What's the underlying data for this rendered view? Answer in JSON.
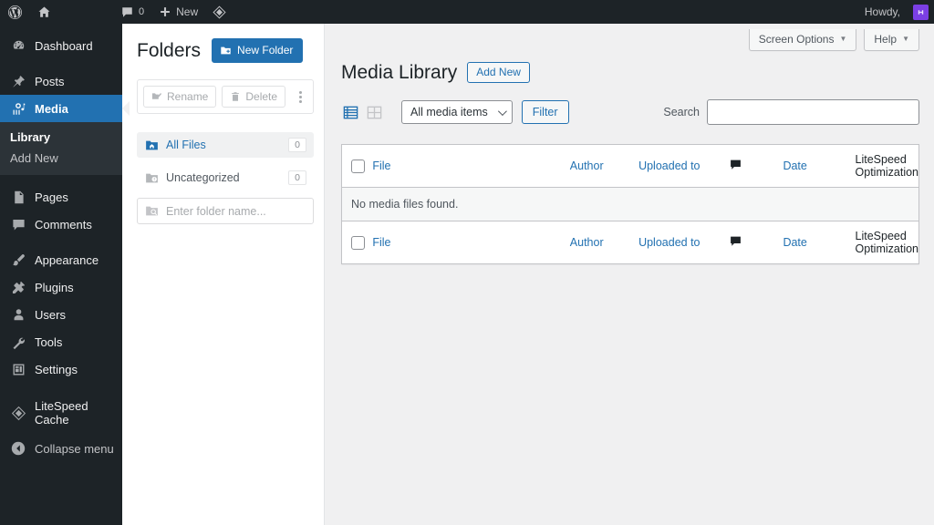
{
  "adminbar": {
    "wp_logo": "wordpress-logo",
    "site_home": "site-home",
    "comments_icon": "comments-icon",
    "comments_count": "0",
    "new_label": "New",
    "litespeed_icon": "litespeed-icon",
    "howdy": "Howdy,",
    "avatar": "avatar"
  },
  "sidebar": {
    "items": [
      {
        "label": "Dashboard",
        "icon": "dashboard-icon",
        "current": false
      },
      {
        "label": "Posts",
        "icon": "pin-icon",
        "current": false
      },
      {
        "label": "Media",
        "icon": "media-icon",
        "current": true
      },
      {
        "label": "Pages",
        "icon": "pages-icon",
        "current": false
      },
      {
        "label": "Comments",
        "icon": "comments-icon",
        "current": false
      },
      {
        "label": "Appearance",
        "icon": "brush-icon",
        "current": false
      },
      {
        "label": "Plugins",
        "icon": "plugins-icon",
        "current": false
      },
      {
        "label": "Users",
        "icon": "users-icon",
        "current": false
      },
      {
        "label": "Tools",
        "icon": "tools-icon",
        "current": false
      },
      {
        "label": "Settings",
        "icon": "settings-icon",
        "current": false
      },
      {
        "label": "LiteSpeed Cache",
        "icon": "litespeed-icon",
        "current": false
      }
    ],
    "submenu": [
      {
        "label": "Library",
        "current": true
      },
      {
        "label": "Add New",
        "current": false
      }
    ],
    "collapse_label": "Collapse menu",
    "collapse_icon": "collapse-arrow-icon",
    "active_color": "#2271b1"
  },
  "folders": {
    "title": "Folders",
    "new_folder_label": "New Folder",
    "new_folder_icon": "folder-plus-icon",
    "rename_label": "Rename",
    "rename_icon": "rename-folder-icon",
    "delete_label": "Delete",
    "delete_icon": "trash-icon",
    "more_icon": "kebab-menu-icon",
    "list": [
      {
        "label": "All Files",
        "count": "0",
        "icon": "home-folder-icon",
        "active": true
      },
      {
        "label": "Uncategorized",
        "count": "0",
        "icon": "folder-icon",
        "active": false
      }
    ],
    "new_folder_placeholder": "Enter folder name...",
    "new_folder_input_value": "",
    "search_folder_icon": "folder-search-icon"
  },
  "screen_meta": {
    "screen_options": "Screen Options",
    "help": "Help",
    "caret": "▼"
  },
  "main": {
    "page_title": "Media Library",
    "add_new_label": "Add New",
    "view_list_icon": "list-view-icon",
    "view_grid_icon": "grid-view-icon",
    "media_filter_selected": "All media items",
    "filter_label": "Filter",
    "search_label": "Search",
    "search_value": "",
    "search_placeholder": ""
  },
  "table": {
    "columns": {
      "file": "File",
      "author": "Author",
      "uploaded_to": "Uploaded to",
      "comments_icon": "comments-column-icon",
      "date": "Date",
      "litespeed": "LiteSpeed Optimization"
    },
    "empty_message": "No media files found."
  }
}
